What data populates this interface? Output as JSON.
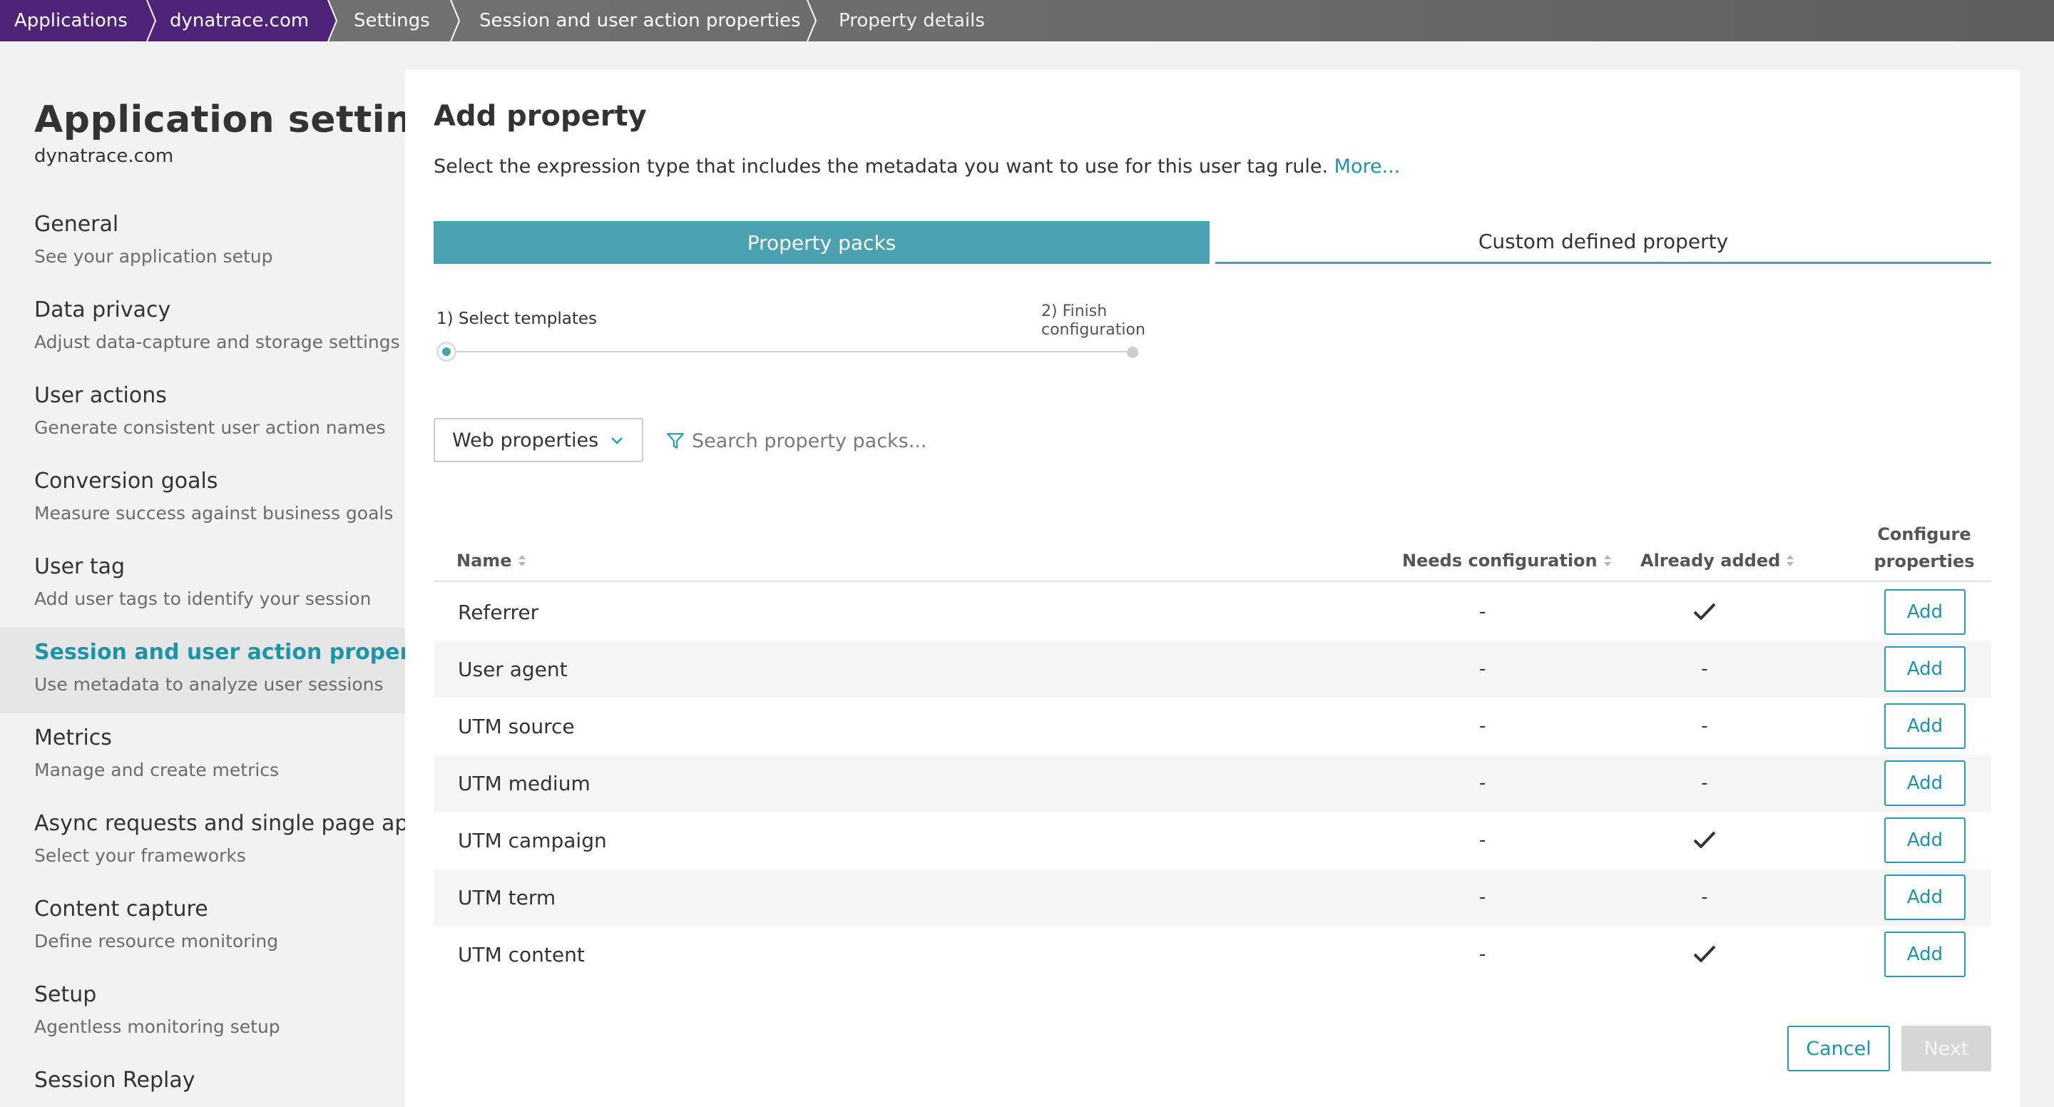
{
  "breadcrumb": [
    {
      "label": "Applications"
    },
    {
      "label": "dynatrace.com"
    },
    {
      "label": "Settings"
    },
    {
      "label": "Session and user action properties"
    },
    {
      "label": "Property details"
    }
  ],
  "sidebar": {
    "title": "Application settings",
    "subtitle": "dynatrace.com",
    "items": [
      {
        "label": "General",
        "desc": "See your application setup"
      },
      {
        "label": "Data privacy",
        "desc": "Adjust data-capture and storage settings"
      },
      {
        "label": "User actions",
        "desc": "Generate consistent user action names"
      },
      {
        "label": "Conversion goals",
        "desc": "Measure success against business goals"
      },
      {
        "label": "User tag",
        "desc": "Add user tags to identify your session"
      },
      {
        "label": "Session and user action properties",
        "desc": "Use metadata to analyze user sessions",
        "active": true
      },
      {
        "label": "Metrics",
        "desc": "Manage and create metrics"
      },
      {
        "label": "Async requests and single page apps",
        "desc": "Select your frameworks"
      },
      {
        "label": "Content capture",
        "desc": "Define resource monitoring"
      },
      {
        "label": "Setup",
        "desc": "Agentless monitoring setup"
      },
      {
        "label": "Session Replay",
        "desc": ""
      }
    ]
  },
  "panel": {
    "title": "Add property",
    "intro": "Select the expression type that includes the metadata you want to use for this user tag rule.",
    "more_link": "More...",
    "tabs": [
      {
        "label": "Property packs",
        "selected": true
      },
      {
        "label": "Custom defined property",
        "selected": false
      }
    ],
    "steps": [
      {
        "label": "1) Select templates"
      },
      {
        "label": "2) Finish configuration"
      }
    ],
    "dropdown_value": "Web properties",
    "search_placeholder": "Search property packs...",
    "table": {
      "headers": {
        "name": "Name",
        "needs_config": "Needs configuration",
        "already_added": "Already added",
        "configure": "Configure properties"
      },
      "rows": [
        {
          "name": "Referrer",
          "needs_config": "-",
          "already_added": true
        },
        {
          "name": "User agent",
          "needs_config": "-",
          "already_added": false
        },
        {
          "name": "UTM source",
          "needs_config": "-",
          "already_added": false
        },
        {
          "name": "UTM medium",
          "needs_config": "-",
          "already_added": false
        },
        {
          "name": "UTM campaign",
          "needs_config": "-",
          "already_added": true
        },
        {
          "name": "UTM term",
          "needs_config": "-",
          "already_added": false
        },
        {
          "name": "UTM content",
          "needs_config": "-",
          "already_added": true
        }
      ],
      "add_label": "Add",
      "not_added_text": "-"
    },
    "cancel_label": "Cancel",
    "next_label": "Next"
  },
  "colors": {
    "accent": "#4aa1b0",
    "link": "#1f93a8",
    "breadcrumb_purple": "#4f2478",
    "breadcrumb_gray": "#6a6a6a"
  }
}
